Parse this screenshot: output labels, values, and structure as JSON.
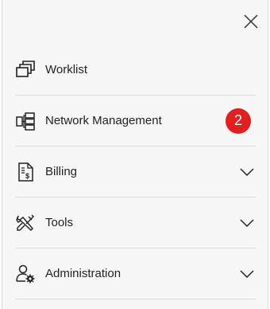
{
  "colors": {
    "badge_bg": "#e11f1f",
    "panel_bg": "#f7f7f7",
    "divider": "#dcdcdc",
    "text": "#222222"
  },
  "close": {
    "icon": "close-icon"
  },
  "menu": [
    {
      "label": "Worklist",
      "icon": "worklist-icon",
      "expandable": false
    },
    {
      "label": "Network Management",
      "icon": "network-icon",
      "expandable": false,
      "badge": "2"
    },
    {
      "label": "Billing",
      "icon": "billing-icon",
      "expandable": true
    },
    {
      "label": "Tools",
      "icon": "tools-icon",
      "expandable": true
    },
    {
      "label": "Administration",
      "icon": "admin-icon",
      "expandable": true
    }
  ]
}
